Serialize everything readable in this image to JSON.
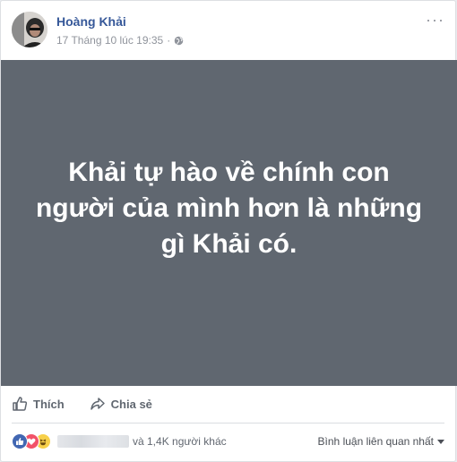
{
  "post": {
    "author": "Hoàng Khải",
    "timestamp": "17 Tháng 10 lúc 19:35",
    "audience_icon": "globe-icon",
    "more_icon": "more-options-icon",
    "more_label": "···",
    "status_text": "Khải tự hào về chính con người của mình hơn là những gì Khải có.",
    "status_bg_color": "#606770",
    "status_text_color": "#ffffff"
  },
  "actions": {
    "like_label": "Thích",
    "share_label": "Chia sẻ"
  },
  "reactions": {
    "icons": [
      "like-reaction-icon",
      "love-reaction-icon",
      "haha-reaction-icon"
    ],
    "others_text": "và 1,4K người khác",
    "sort_label": "Bình luận liên quan nhất"
  },
  "colors": {
    "author_link": "#365899",
    "like_blue": "#4267b2",
    "love_red": "#f25268",
    "haha_yellow": "#f7d04a"
  }
}
